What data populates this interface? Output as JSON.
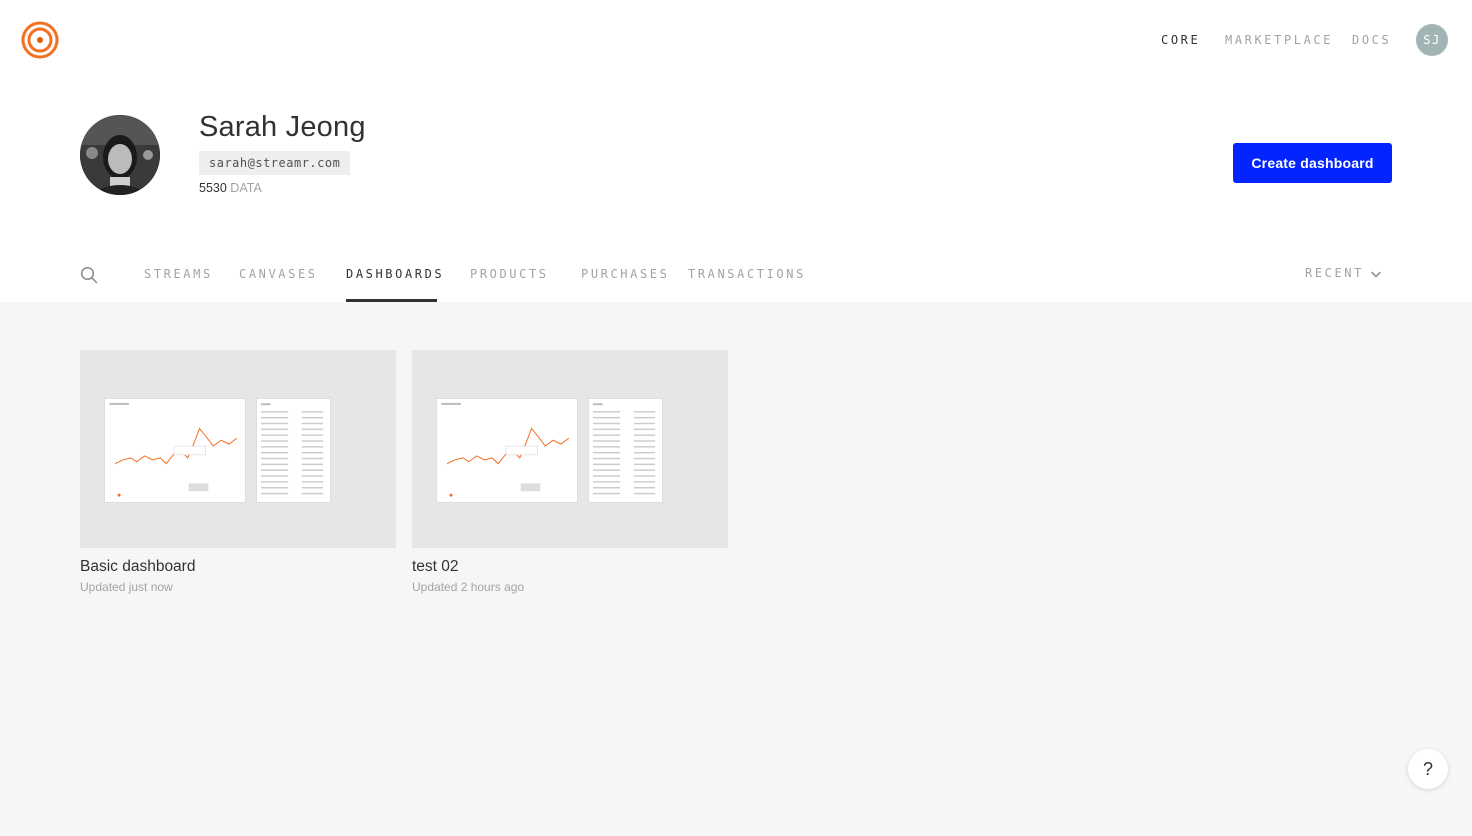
{
  "nav": {
    "core": "CORE",
    "marketplace": "MARKETPLACE",
    "docs": "DOCS",
    "avatar_initials": "SJ"
  },
  "profile": {
    "name": "Sarah Jeong",
    "email": "sarah@streamr.com",
    "balance_value": "5530",
    "balance_unit": "DATA"
  },
  "actions": {
    "create_label": "Create dashboard"
  },
  "tabs": [
    {
      "label": "STREAMS",
      "active": false
    },
    {
      "label": "CANVASES",
      "active": false
    },
    {
      "label": "DASHBOARDS",
      "active": true
    },
    {
      "label": "PRODUCTS",
      "active": false
    },
    {
      "label": "PURCHASES",
      "active": false
    },
    {
      "label": "TRANSACTIONS",
      "active": false
    }
  ],
  "sort": {
    "label": "RECENT"
  },
  "dashboards": [
    {
      "title": "Basic dashboard",
      "updated": "Updated just now"
    },
    {
      "title": "test 02",
      "updated": "Updated 2 hours ago"
    }
  ],
  "help": {
    "label": "?"
  },
  "colors": {
    "accent": "#0324ff",
    "brand": "#ff5c00",
    "background": "#f6f6f6"
  }
}
